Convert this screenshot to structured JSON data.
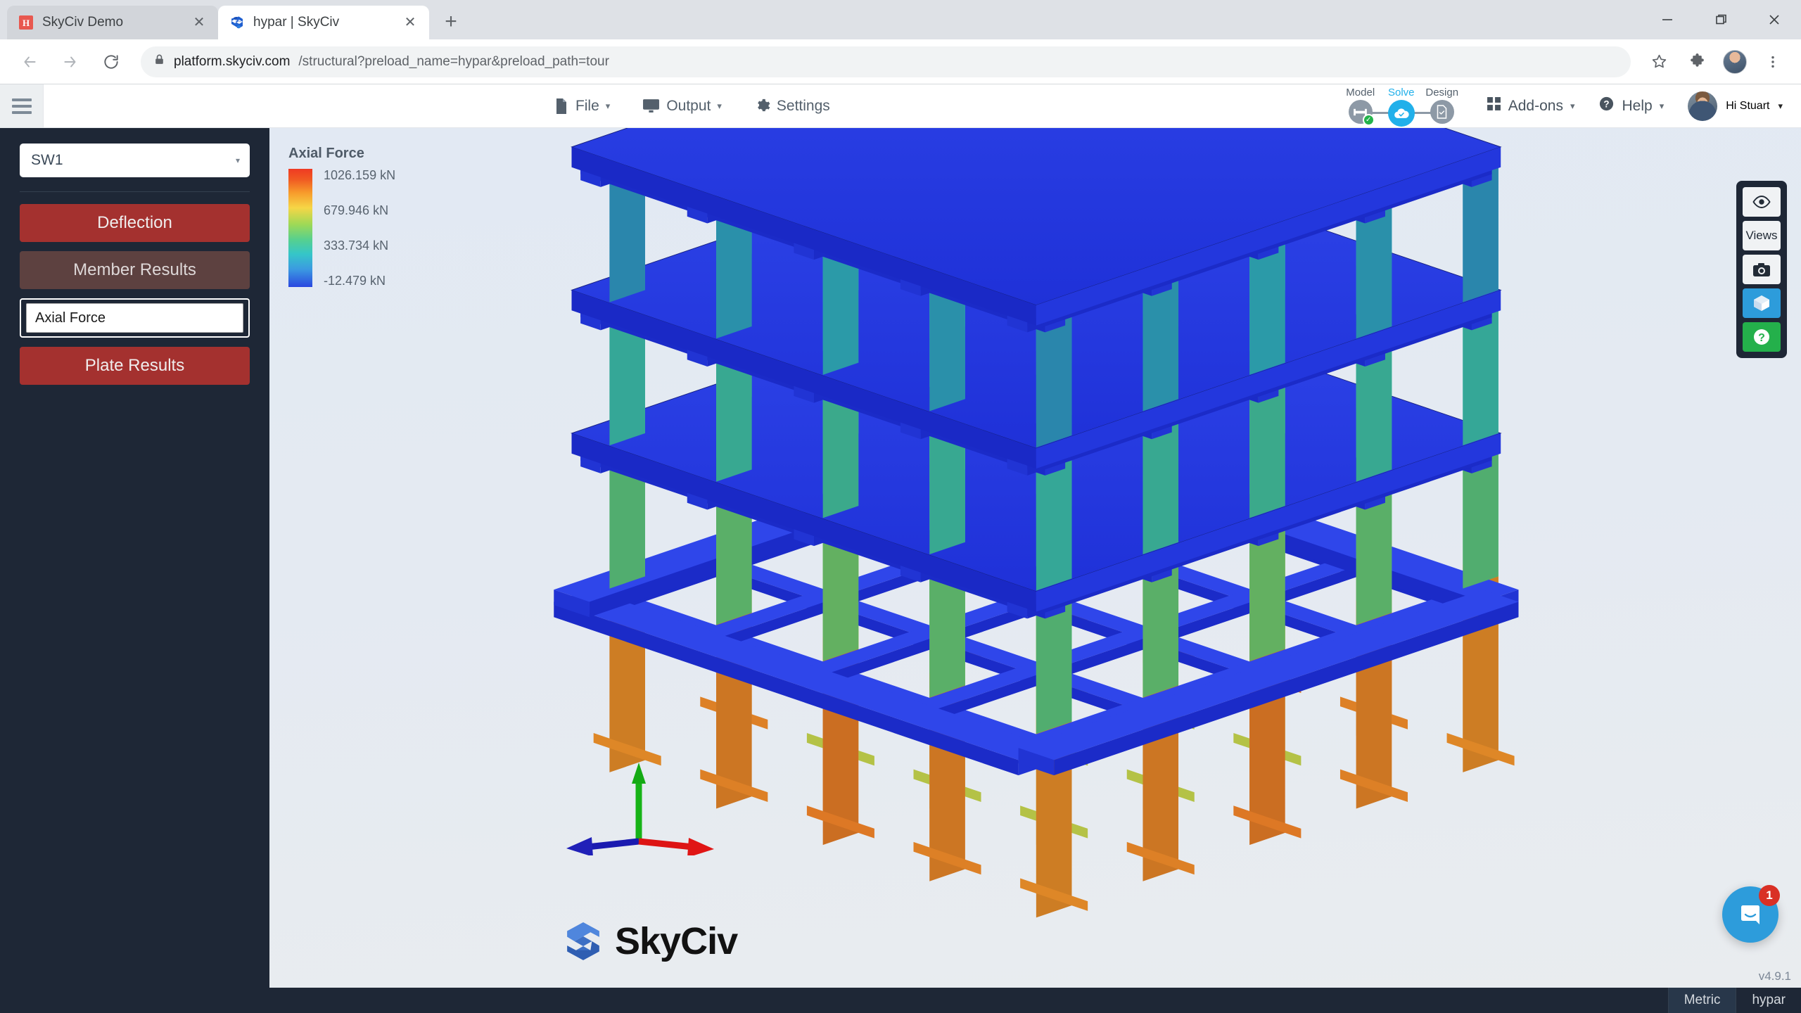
{
  "browser": {
    "tabs": [
      {
        "title": "SkyCiv Demo",
        "favicon": "skyciv-red-icon",
        "active": false
      },
      {
        "title": "hypar | SkyCiv",
        "favicon": "skyciv-blue-icon",
        "active": true
      }
    ],
    "new_tab_label": "+",
    "close_label": "✕",
    "window_controls": {
      "minimize": "—",
      "maximize": "❐",
      "close": "✕"
    },
    "nav": {
      "back": "←",
      "forward": "→",
      "reload": "⟳"
    },
    "url_secure_icon": "lock-icon",
    "url_host": "platform.skyciv.com",
    "url_path": "/structural?preload_name=hypar&preload_path=tour",
    "toolbar_icons": [
      "bookmark-star-icon",
      "extensions-puzzle-icon",
      "profile-avatar",
      "chrome-menu-icon"
    ]
  },
  "app": {
    "menu": [
      {
        "label": "File",
        "icon": "file-icon",
        "caret": "▾"
      },
      {
        "label": "Output",
        "icon": "monitor-icon",
        "caret": "▾"
      },
      {
        "label": "Settings",
        "icon": "gear-icon",
        "caret": ""
      }
    ],
    "stepper": [
      {
        "label": "Model",
        "icon": "beam-icon",
        "active": false,
        "complete": true
      },
      {
        "label": "Solve",
        "icon": "cloud-check-icon",
        "active": true,
        "complete": false
      },
      {
        "label": "Design",
        "icon": "document-check-icon",
        "active": false,
        "complete": false
      }
    ],
    "addons_label": "Add-ons",
    "addons_caret": "▾",
    "help_label": "Help",
    "help_caret": "▾",
    "user_label": "Hi Stuart",
    "user_caret": "▾"
  },
  "sidebar": {
    "load_case": "SW1",
    "load_case_caret": "▾",
    "deflection_label": "Deflection",
    "member_results_label": "Member Results",
    "result_type": "Axial Force",
    "result_type_caret": "ⱟ",
    "plate_results_label": "Plate Results"
  },
  "legend": {
    "title": "Axial Force",
    "ticks": [
      "1026.159 kN",
      "679.946 kN",
      "333.734 kN",
      "-12.479 kN"
    ]
  },
  "viewport": {
    "brand_word": "SkyCiv",
    "brand_mark": "skyciv-hex-logo",
    "axis_triad": {
      "y_up": "green",
      "x_right": "red",
      "z_left": "blue"
    },
    "right_tools": [
      {
        "name": "visibility-eye-icon",
        "label": "",
        "style": "light"
      },
      {
        "name": "views-button",
        "label": "Views",
        "style": "light"
      },
      {
        "name": "camera-screenshot-icon",
        "label": "",
        "style": "light"
      },
      {
        "name": "render-3d-cube-icon",
        "label": "",
        "style": "blue"
      },
      {
        "name": "help-question-icon",
        "label": "",
        "style": "green"
      }
    ],
    "chat_badge": "1",
    "version": "v4.9.1"
  },
  "statusbar": {
    "units": "Metric",
    "model_name": "hypar"
  },
  "model": {
    "type": "3d-structural-frame",
    "storeys": 4,
    "result_plot": "Axial Force",
    "slab_color": "#2235e0",
    "column_color_scale": [
      "#2b47e0",
      "#35c6c8",
      "#56d08f",
      "#9ed956",
      "#f6d646",
      "#f79a2b",
      "#ef3a23"
    ]
  }
}
